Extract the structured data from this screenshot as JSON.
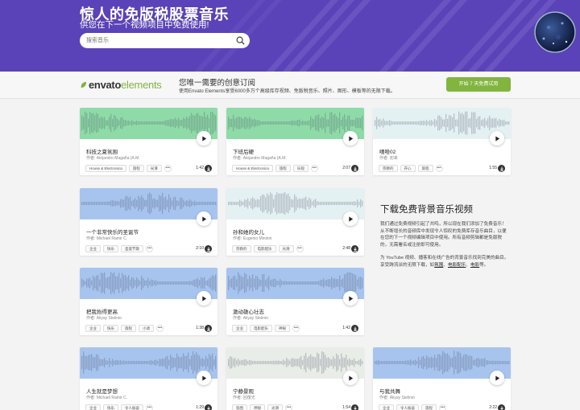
{
  "hero": {
    "title": "惊人的免版税股票音乐",
    "subtitle": "供您在下一个视频项目中免费使用!",
    "search_placeholder": "搜索音乐"
  },
  "envato": {
    "brand_part1": "envato",
    "brand_part2": "elements",
    "title": "您唯一需要的创意订阅",
    "description": "使用Envato Elements享受6000多万个高级库存视频、免版税音乐、照片、图形、模板等的无限下载。",
    "cta": "开始 7 天免费试用"
  },
  "tracks": [
    {
      "title": "科技之夏氛围",
      "author": "作者: Alejandro Magaña (A.M.",
      "tags": [
        "House & Electronica",
        "旅程",
        "光滑"
      ],
      "duration": "1:42",
      "wave_color": "#8fdba8"
    },
    {
      "title": "下班后硬",
      "author": "作者: Alejandro Magaña (A.M.",
      "tags": [
        "House & Electronica",
        "旅程",
        "乐观"
      ],
      "duration": "2:07",
      "wave_color": "#8fdba8"
    },
    {
      "title": "嘻哈02",
      "author": "作者: 初来",
      "tags": [
        "宗教的",
        "开心",
        "旅程"
      ],
      "duration": "1:55",
      "wave_color": "#e4f1f3"
    },
    {
      "title": "一个非常快乐的圣诞节",
      "author": "作者: Michael Ramir C.",
      "tags": [
        "企业",
        "快乐",
        "圣诞节歌"
      ],
      "duration": "2:10",
      "wave_color": "#a7c4ef"
    },
    {
      "title": "孙和她的女儿",
      "author": "作者: Eugenio Mininni",
      "tags": [
        "宗教的",
        "电影配乐",
        "光滑"
      ],
      "duration": "2:48",
      "wave_color": "#e4f1f3"
    },
    {
      "title": "把我抬得更高",
      "author": "作者: Aliyay Stelinio",
      "tags": [
        "企业",
        "快乐",
        "旅程",
        "小调"
      ],
      "duration": "1:38",
      "wave_color": "#a7c4ef"
    },
    {
      "title": "激动雄心壮志",
      "author": "作者: Aliyay Stelinio",
      "tags": [
        "企业",
        "电影配乐",
        "神秘"
      ],
      "duration": "1:42",
      "wave_color": "#a7c4ef"
    },
    {
      "title": "人生就是梦想",
      "author": "作者: Michael Ramir C.",
      "tags": [
        "企业",
        "快乐",
        "令人振奋"
      ],
      "duration": "1:29",
      "wave_color": "#a7c4ef"
    },
    {
      "title": "宁静景观",
      "author": "作者: 回復光",
      "tags": [
        "氛围",
        "神秘",
        "光滑"
      ],
      "duration": "1:54",
      "wave_color": "#e9ede8"
    },
    {
      "title": "与我共舞",
      "author": "作者: Aliyay Stelinio",
      "tags": [
        "企业",
        "令人振奋",
        "旅程"
      ],
      "duration": "2:22",
      "wave_color": "#a7c4ef"
    }
  ],
  "info": {
    "heading": "下载免费背景音乐视频",
    "para1": "我们通过免费视频引起了共鸣，所以现在我们添加了免费音乐！从不断增长的音频库中发现令人惊叹的免费库存音乐曲目，以便在您的下一个视频编辑项目中使用。所有音频剪辑都是免版税的，无需署名或注册即可使用。",
    "para2_prefix": "为 YouTube 视频、播客和在线广告的背景音乐找到完美的曲目。享受跨流派的无限下载，如",
    "link_ambient": "氛围",
    "sep1": "、",
    "link_cinematic": "电影配乐",
    "sep2": "、",
    "link_electronic": "电影",
    "para2_suffix": "等。"
  },
  "more_label": "•••"
}
